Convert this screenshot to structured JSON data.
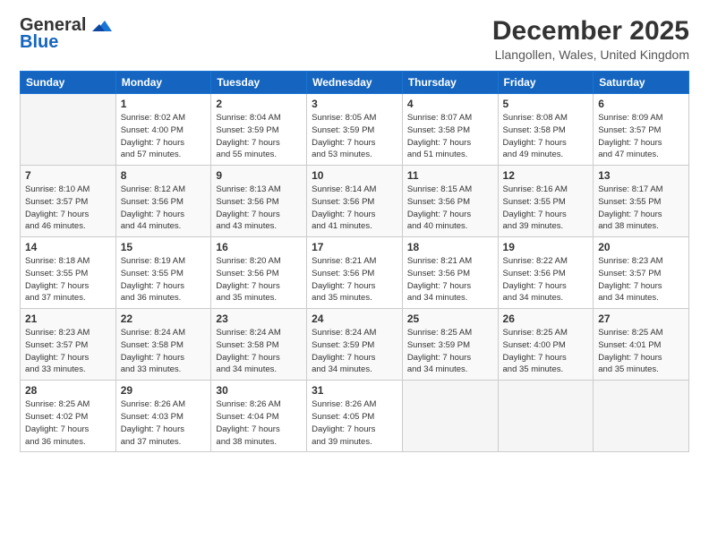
{
  "logo": {
    "general": "General",
    "blue": "Blue"
  },
  "header": {
    "title": "December 2025",
    "subtitle": "Llangollen, Wales, United Kingdom"
  },
  "weekdays": [
    "Sunday",
    "Monday",
    "Tuesday",
    "Wednesday",
    "Thursday",
    "Friday",
    "Saturday"
  ],
  "weeks": [
    [
      {
        "day": "",
        "info": ""
      },
      {
        "day": "1",
        "info": "Sunrise: 8:02 AM\nSunset: 4:00 PM\nDaylight: 7 hours\nand 57 minutes."
      },
      {
        "day": "2",
        "info": "Sunrise: 8:04 AM\nSunset: 3:59 PM\nDaylight: 7 hours\nand 55 minutes."
      },
      {
        "day": "3",
        "info": "Sunrise: 8:05 AM\nSunset: 3:59 PM\nDaylight: 7 hours\nand 53 minutes."
      },
      {
        "day": "4",
        "info": "Sunrise: 8:07 AM\nSunset: 3:58 PM\nDaylight: 7 hours\nand 51 minutes."
      },
      {
        "day": "5",
        "info": "Sunrise: 8:08 AM\nSunset: 3:58 PM\nDaylight: 7 hours\nand 49 minutes."
      },
      {
        "day": "6",
        "info": "Sunrise: 8:09 AM\nSunset: 3:57 PM\nDaylight: 7 hours\nand 47 minutes."
      }
    ],
    [
      {
        "day": "7",
        "info": "Sunrise: 8:10 AM\nSunset: 3:57 PM\nDaylight: 7 hours\nand 46 minutes."
      },
      {
        "day": "8",
        "info": "Sunrise: 8:12 AM\nSunset: 3:56 PM\nDaylight: 7 hours\nand 44 minutes."
      },
      {
        "day": "9",
        "info": "Sunrise: 8:13 AM\nSunset: 3:56 PM\nDaylight: 7 hours\nand 43 minutes."
      },
      {
        "day": "10",
        "info": "Sunrise: 8:14 AM\nSunset: 3:56 PM\nDaylight: 7 hours\nand 41 minutes."
      },
      {
        "day": "11",
        "info": "Sunrise: 8:15 AM\nSunset: 3:56 PM\nDaylight: 7 hours\nand 40 minutes."
      },
      {
        "day": "12",
        "info": "Sunrise: 8:16 AM\nSunset: 3:55 PM\nDaylight: 7 hours\nand 39 minutes."
      },
      {
        "day": "13",
        "info": "Sunrise: 8:17 AM\nSunset: 3:55 PM\nDaylight: 7 hours\nand 38 minutes."
      }
    ],
    [
      {
        "day": "14",
        "info": "Sunrise: 8:18 AM\nSunset: 3:55 PM\nDaylight: 7 hours\nand 37 minutes."
      },
      {
        "day": "15",
        "info": "Sunrise: 8:19 AM\nSunset: 3:55 PM\nDaylight: 7 hours\nand 36 minutes."
      },
      {
        "day": "16",
        "info": "Sunrise: 8:20 AM\nSunset: 3:56 PM\nDaylight: 7 hours\nand 35 minutes."
      },
      {
        "day": "17",
        "info": "Sunrise: 8:21 AM\nSunset: 3:56 PM\nDaylight: 7 hours\nand 35 minutes."
      },
      {
        "day": "18",
        "info": "Sunrise: 8:21 AM\nSunset: 3:56 PM\nDaylight: 7 hours\nand 34 minutes."
      },
      {
        "day": "19",
        "info": "Sunrise: 8:22 AM\nSunset: 3:56 PM\nDaylight: 7 hours\nand 34 minutes."
      },
      {
        "day": "20",
        "info": "Sunrise: 8:23 AM\nSunset: 3:57 PM\nDaylight: 7 hours\nand 34 minutes."
      }
    ],
    [
      {
        "day": "21",
        "info": "Sunrise: 8:23 AM\nSunset: 3:57 PM\nDaylight: 7 hours\nand 33 minutes."
      },
      {
        "day": "22",
        "info": "Sunrise: 8:24 AM\nSunset: 3:58 PM\nDaylight: 7 hours\nand 33 minutes."
      },
      {
        "day": "23",
        "info": "Sunrise: 8:24 AM\nSunset: 3:58 PM\nDaylight: 7 hours\nand 34 minutes."
      },
      {
        "day": "24",
        "info": "Sunrise: 8:24 AM\nSunset: 3:59 PM\nDaylight: 7 hours\nand 34 minutes."
      },
      {
        "day": "25",
        "info": "Sunrise: 8:25 AM\nSunset: 3:59 PM\nDaylight: 7 hours\nand 34 minutes."
      },
      {
        "day": "26",
        "info": "Sunrise: 8:25 AM\nSunset: 4:00 PM\nDaylight: 7 hours\nand 35 minutes."
      },
      {
        "day": "27",
        "info": "Sunrise: 8:25 AM\nSunset: 4:01 PM\nDaylight: 7 hours\nand 35 minutes."
      }
    ],
    [
      {
        "day": "28",
        "info": "Sunrise: 8:25 AM\nSunset: 4:02 PM\nDaylight: 7 hours\nand 36 minutes."
      },
      {
        "day": "29",
        "info": "Sunrise: 8:26 AM\nSunset: 4:03 PM\nDaylight: 7 hours\nand 37 minutes."
      },
      {
        "day": "30",
        "info": "Sunrise: 8:26 AM\nSunset: 4:04 PM\nDaylight: 7 hours\nand 38 minutes."
      },
      {
        "day": "31",
        "info": "Sunrise: 8:26 AM\nSunset: 4:05 PM\nDaylight: 7 hours\nand 39 minutes."
      },
      {
        "day": "",
        "info": ""
      },
      {
        "day": "",
        "info": ""
      },
      {
        "day": "",
        "info": ""
      }
    ]
  ]
}
